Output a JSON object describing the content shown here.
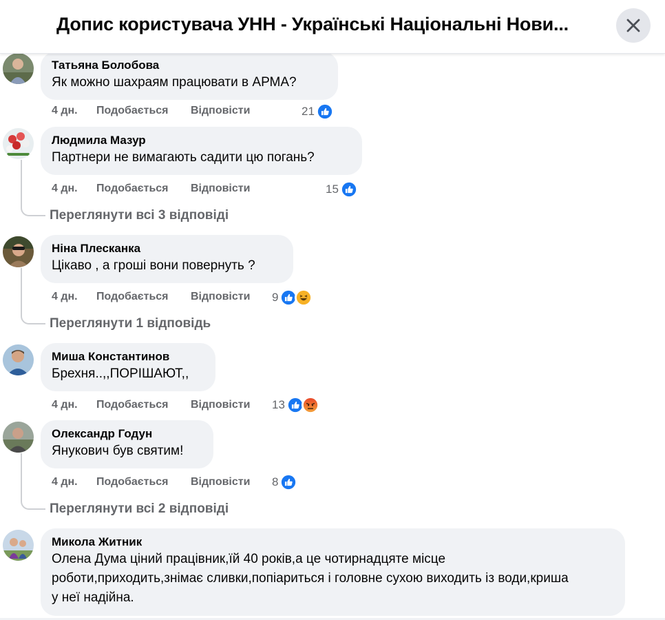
{
  "header": {
    "title": "Допис користувача УНН - Українські Національні Нови..."
  },
  "comments": [
    {
      "author": "Татьяна Болобова",
      "text": "Як можно шахраям працювати в АРМА?",
      "time": "4 дн.",
      "like_label": "Подобається",
      "reply_label": "Відповісти",
      "reaction_count": "21",
      "reactions": [
        "like"
      ]
    },
    {
      "author": "Людмила Мазур",
      "text": "Партнери не вимагають садити цю погань?",
      "time": "4 дн.",
      "like_label": "Подобається",
      "reply_label": "Відповісти",
      "reaction_count": "15",
      "reactions": [
        "like"
      ],
      "view_replies": "Переглянути всі 3 відповіді"
    },
    {
      "author": "Ніна Плесканка",
      "text": "Цікаво , а гроші вони повернуть ?",
      "time": "4 дн.",
      "like_label": "Подобається",
      "reply_label": "Відповісти",
      "reaction_count": "9",
      "reactions": [
        "like",
        "haha"
      ],
      "view_replies": "Переглянути 1 відповідь"
    },
    {
      "author": "Миша Константинов",
      "text": "Брехня..,,ПОРІШАЮТ,,",
      "time": "4 дн.",
      "like_label": "Подобається",
      "reply_label": "Відповісти",
      "reaction_count": "13",
      "reactions": [
        "like",
        "angry"
      ]
    },
    {
      "author": "Олександр Годун",
      "text": "Янукович був святим!",
      "time": "4 дн.",
      "like_label": "Подобається",
      "reply_label": "Відповісти",
      "reaction_count": "8",
      "reactions": [
        "like"
      ],
      "view_replies": "Переглянути всі 2 відповіді"
    },
    {
      "author": "Микола Житник",
      "text": "Олена Дума ціний працівник,їй 40 років,а це чотирнадцяте місце роботи,приходить,знімає сливки,попіариться і головне сухою виходить із води,криша у неї надійна."
    }
  ],
  "colors": {
    "like_blue": "#1877f2",
    "bubble_bg": "#f0f2f5",
    "secondary_text": "#65676b",
    "haha_yellow": "#f7b125",
    "angry_orange": "#e9710f"
  }
}
